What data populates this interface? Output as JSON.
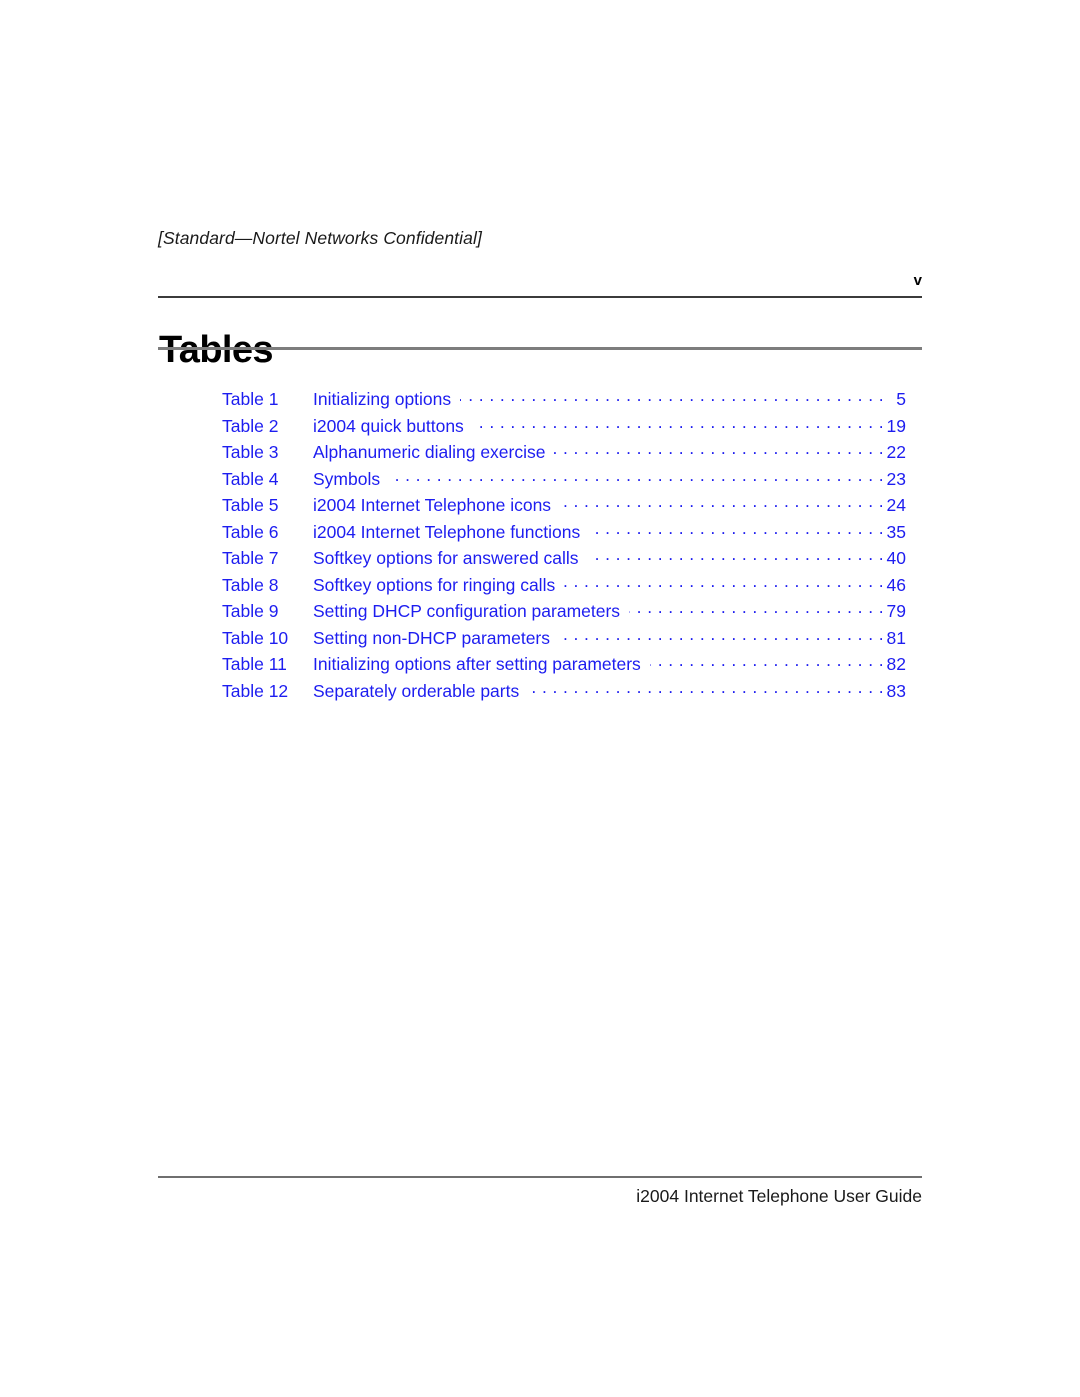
{
  "document": {
    "header_note": "[Standard—Nortel Networks Confidential]",
    "folio": "v",
    "title": "Tables",
    "footer": "i2004 Internet Telephone User Guide",
    "link_color": "#1d1df0",
    "text_color": "#1a1a1a",
    "rule_color_top": "#3b3b3b",
    "rule_color_title": "#7d7d7d",
    "rule_color_footer": "#6f6f6f"
  },
  "toc": {
    "entries": [
      {
        "label": "Table 1",
        "title": "Initializing options",
        "page": "5"
      },
      {
        "label": "Table 2",
        "title": "i2004 quick buttons",
        "page": "19"
      },
      {
        "label": "Table 3",
        "title": "Alphanumeric dialing exercise",
        "page": "22"
      },
      {
        "label": "Table 4",
        "title": "Symbols",
        "page": "23"
      },
      {
        "label": "Table 5",
        "title": "i2004 Internet Telephone icons",
        "page": "24"
      },
      {
        "label": "Table 6",
        "title": "i2004 Internet Telephone functions",
        "page": "35"
      },
      {
        "label": "Table 7",
        "title": "Softkey options for answered calls",
        "page": "40"
      },
      {
        "label": "Table 8",
        "title": "Softkey options for ringing calls",
        "page": "46"
      },
      {
        "label": "Table 9",
        "title": "Setting DHCP configuration parameters",
        "page": "79"
      },
      {
        "label": "Table 10",
        "title": "Setting non-DHCP parameters",
        "page": "81"
      },
      {
        "label": "Table 11",
        "title": "Initializing options after setting parameters",
        "page": "82"
      },
      {
        "label": "Table 12",
        "title": "Separately orderable parts",
        "page": "83"
      }
    ]
  }
}
